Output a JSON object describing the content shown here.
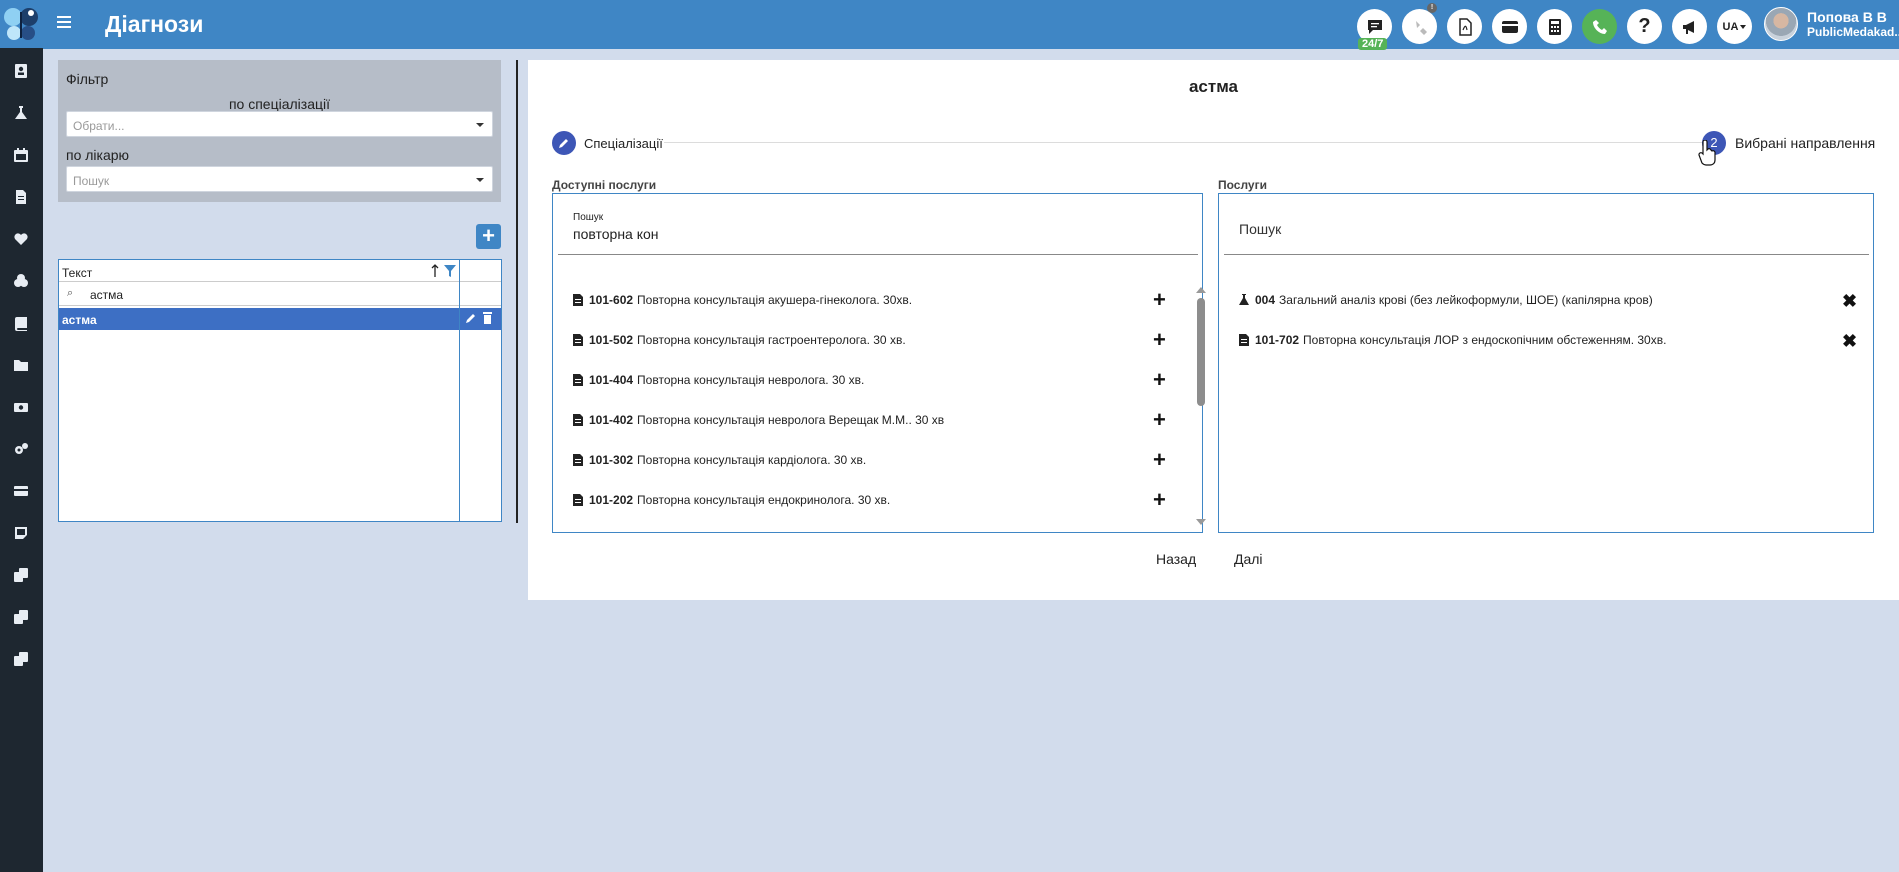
{
  "header": {
    "title": "Діагнози",
    "support_badge": "24/7",
    "lang": "UA",
    "user_name": "Попова В В",
    "user_org": "PublicMedakad..."
  },
  "colors": {
    "primary": "#3f86c5",
    "sidebar": "#1e2730",
    "step": "#3d56b6",
    "selected_row": "#3d6fc4"
  },
  "filter": {
    "title": "Фільтр",
    "by_specialization_label": "по спеціалізації",
    "specialization_placeholder": "Обрати...",
    "by_doctor_label": "по лікарю",
    "doctor_placeholder": "Пошук"
  },
  "grid": {
    "column_text": "Текст",
    "search_value": "астма",
    "rows": [
      "астма"
    ]
  },
  "card": {
    "title": "астма",
    "step1_label": "Спеціалізації",
    "step2_number": "2",
    "step2_label": "Вибрані направлення",
    "available_title": "Доступні послуги",
    "search_small_label": "Пошук",
    "search_value": "повторна кон",
    "services_title": "Послуги",
    "services_search_placeholder": "Пошук",
    "available": [
      {
        "code": "101-602",
        "name": "Повторна консультація акушера-гінеколога. 30хв."
      },
      {
        "code": "101-502",
        "name": "Повторна консультація гастроентеролога. 30 хв."
      },
      {
        "code": "101-404",
        "name": "Повторна консультація невролога. 30 хв."
      },
      {
        "code": "101-402",
        "name": "Повторна консультація невролога Верещак М.М.. 30 хв"
      },
      {
        "code": "101-302",
        "name": "Повторна консультація кардіолога. 30 хв."
      },
      {
        "code": "101-202",
        "name": "Повторна консультація ендокринолога. 30 хв."
      }
    ],
    "selected": [
      {
        "code": "004",
        "name": "Загальний аналіз крові (без лейкоформули, ШОЕ) (капілярна кров)",
        "icon": "flask-icon"
      },
      {
        "code": "101-702",
        "name": "Повторна консультація ЛОР з ендоскопічним обстеженням. 30хв.",
        "icon": "document-icon"
      }
    ],
    "back_label": "Назад",
    "next_label": "Далі"
  }
}
